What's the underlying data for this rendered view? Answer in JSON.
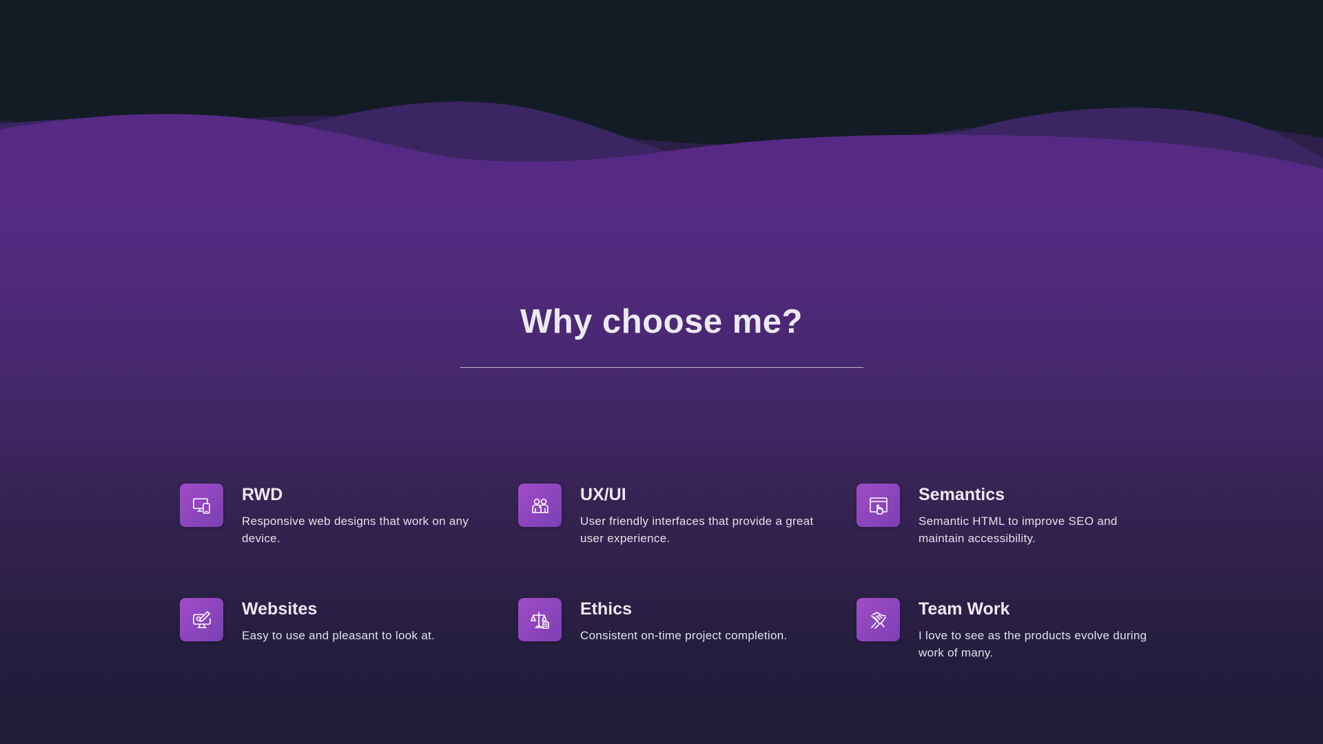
{
  "section": {
    "title": "Why choose me?"
  },
  "colors": {
    "top_background": "#131b24",
    "wave_purple": "#572a85",
    "bottom_background": "#1e1c37",
    "icon_gradient_start": "#a14cc7",
    "icon_gradient_end": "#7b3fb4",
    "text": "#ece9f0"
  },
  "features": [
    {
      "title": "RWD",
      "description": "Responsive web designs that work on any device.",
      "icon": "devices-icon"
    },
    {
      "title": "UX/UI",
      "description": "User friendly interfaces that provide a great user experience.",
      "icon": "users-icon"
    },
    {
      "title": "Semantics",
      "description": "Semantic HTML to improve SEO and maintain accessibility.",
      "icon": "browser-pointer-icon"
    },
    {
      "title": "Websites",
      "description": "Easy to use and pleasant to look at.",
      "icon": "monitor-edit-icon"
    },
    {
      "title": "Ethics",
      "description": "Consistent on-time project completion.",
      "icon": "scales-icon"
    },
    {
      "title": "Team Work",
      "description": "I love to see as the products evolve during work of many.",
      "icon": "handshake-icon"
    }
  ]
}
